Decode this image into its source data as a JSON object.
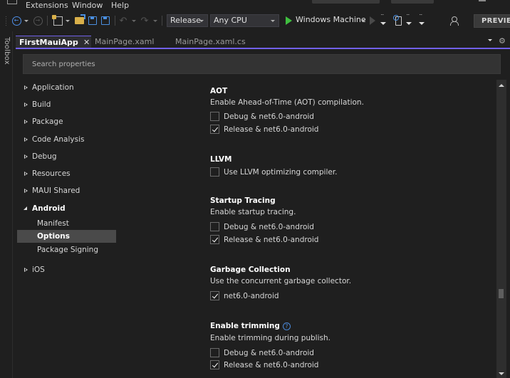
{
  "menubar": {
    "items": [
      "Extensions",
      "Window",
      "Help"
    ]
  },
  "toolbar": {
    "configuration": "Release",
    "platform": "Any CPU",
    "run_target": "Windows Machine",
    "preview_label": "PREVIEW"
  },
  "toolbox": {
    "label": "Toolbox"
  },
  "tabs": [
    {
      "label": "FirstMauiApp",
      "active": true
    },
    {
      "label": "MainPage.xaml",
      "active": false
    },
    {
      "label": "MainPage.xaml.cs",
      "active": false
    }
  ],
  "search": {
    "placeholder": "Search properties",
    "value": ""
  },
  "nav": {
    "items": [
      {
        "label": "Application",
        "expanded": false
      },
      {
        "label": "Build",
        "expanded": false
      },
      {
        "label": "Package",
        "expanded": false
      },
      {
        "label": "Code Analysis",
        "expanded": false
      },
      {
        "label": "Debug",
        "expanded": false
      },
      {
        "label": "Resources",
        "expanded": false
      },
      {
        "label": "MAUI Shared",
        "expanded": false
      },
      {
        "label": "Android",
        "expanded": true
      },
      {
        "label": "iOS",
        "expanded": false
      }
    ],
    "android_children": [
      {
        "label": "Manifest",
        "selected": false
      },
      {
        "label": "Options",
        "selected": true
      },
      {
        "label": "Package Signing",
        "selected": false
      }
    ]
  },
  "sections": {
    "aot": {
      "title": "AOT",
      "description": "Enable Ahead-of-Time (AOT) compilation.",
      "options": [
        {
          "label": "Debug & net6.0-android",
          "checked": false
        },
        {
          "label": "Release & net6.0-android",
          "checked": true
        }
      ]
    },
    "llvm": {
      "title": "LLVM",
      "options": [
        {
          "label": "Use LLVM optimizing compiler.",
          "checked": false
        }
      ]
    },
    "startup_tracing": {
      "title": "Startup Tracing",
      "description": "Enable startup tracing.",
      "options": [
        {
          "label": "Debug & net6.0-android",
          "checked": false
        },
        {
          "label": "Release & net6.0-android",
          "checked": true
        }
      ]
    },
    "garbage_collection": {
      "title": "Garbage Collection",
      "description": "Use the concurrent garbage collector.",
      "options": [
        {
          "label": "net6.0-android",
          "checked": true
        }
      ]
    },
    "trimming": {
      "title": "Enable trimming",
      "help_glyph": "?",
      "description": "Enable trimming during publish.",
      "options": [
        {
          "label": "Debug & net6.0-android",
          "checked": false
        },
        {
          "label": "Release & net6.0-android",
          "checked": true
        }
      ]
    }
  },
  "colors": {
    "accent": "#7160e8",
    "run_green": "#3fbf3f",
    "background": "#1f1f1f",
    "selected_nav": "#4a4a4a"
  }
}
